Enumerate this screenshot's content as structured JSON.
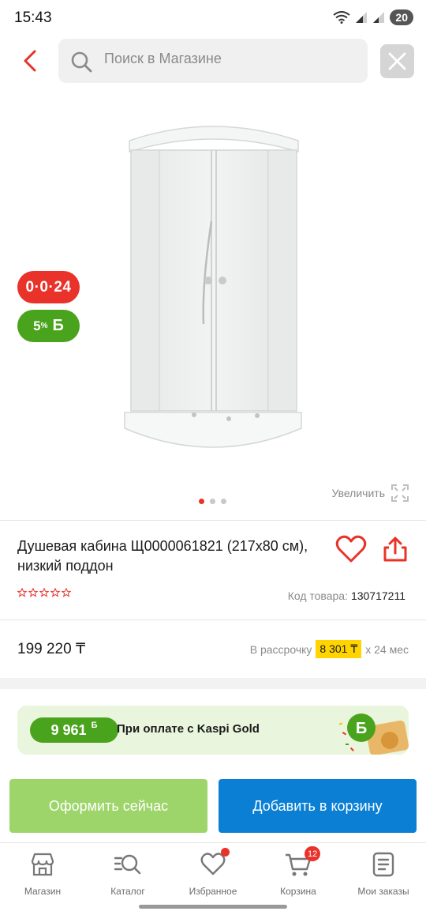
{
  "status": {
    "time": "15:43",
    "battery": "20"
  },
  "search": {
    "placeholder": "Поиск в Магазине"
  },
  "product": {
    "title": "Душевая кабина Щ0000061821 (217x80 см), низкий поддон",
    "sku_label": "Код товара:",
    "sku_value": "130717211",
    "price": "199 220 ₸",
    "rating_stars": 0,
    "image_count": 3,
    "active_image": 0
  },
  "badges": {
    "installment": "0·0·24",
    "bonus_percent": "5",
    "bonus_percent_sign": "%",
    "bonus_symbol": "Б"
  },
  "gallery": {
    "zoom_label": "Увеличить"
  },
  "installment": {
    "prefix": "В рассрочку",
    "amount": "8 301 ₸",
    "suffix": "x 24 мес"
  },
  "kaspi_gold": {
    "bonus": "9 961",
    "bonus_symbol": "Б",
    "text": "При оплате с Kaspi Gold"
  },
  "actions": {
    "order_now": "Оформить сейчас",
    "add_to_cart": "Добавить в корзину"
  },
  "nav": {
    "items": [
      {
        "label": "Магазин",
        "icon": "store-icon"
      },
      {
        "label": "Каталог",
        "icon": "catalog-search-icon"
      },
      {
        "label": "Избранное",
        "icon": "heart-icon"
      },
      {
        "label": "Корзина",
        "icon": "cart-icon"
      },
      {
        "label": "Мои заказы",
        "icon": "orders-icon"
      }
    ],
    "cart_count": "12"
  },
  "colors": {
    "accent_red": "#e8322a",
    "kaspi_green": "#4aa31c",
    "cart_blue": "#0a7fd4",
    "order_green": "#9ed56b",
    "installment_yellow": "#ffd400"
  }
}
